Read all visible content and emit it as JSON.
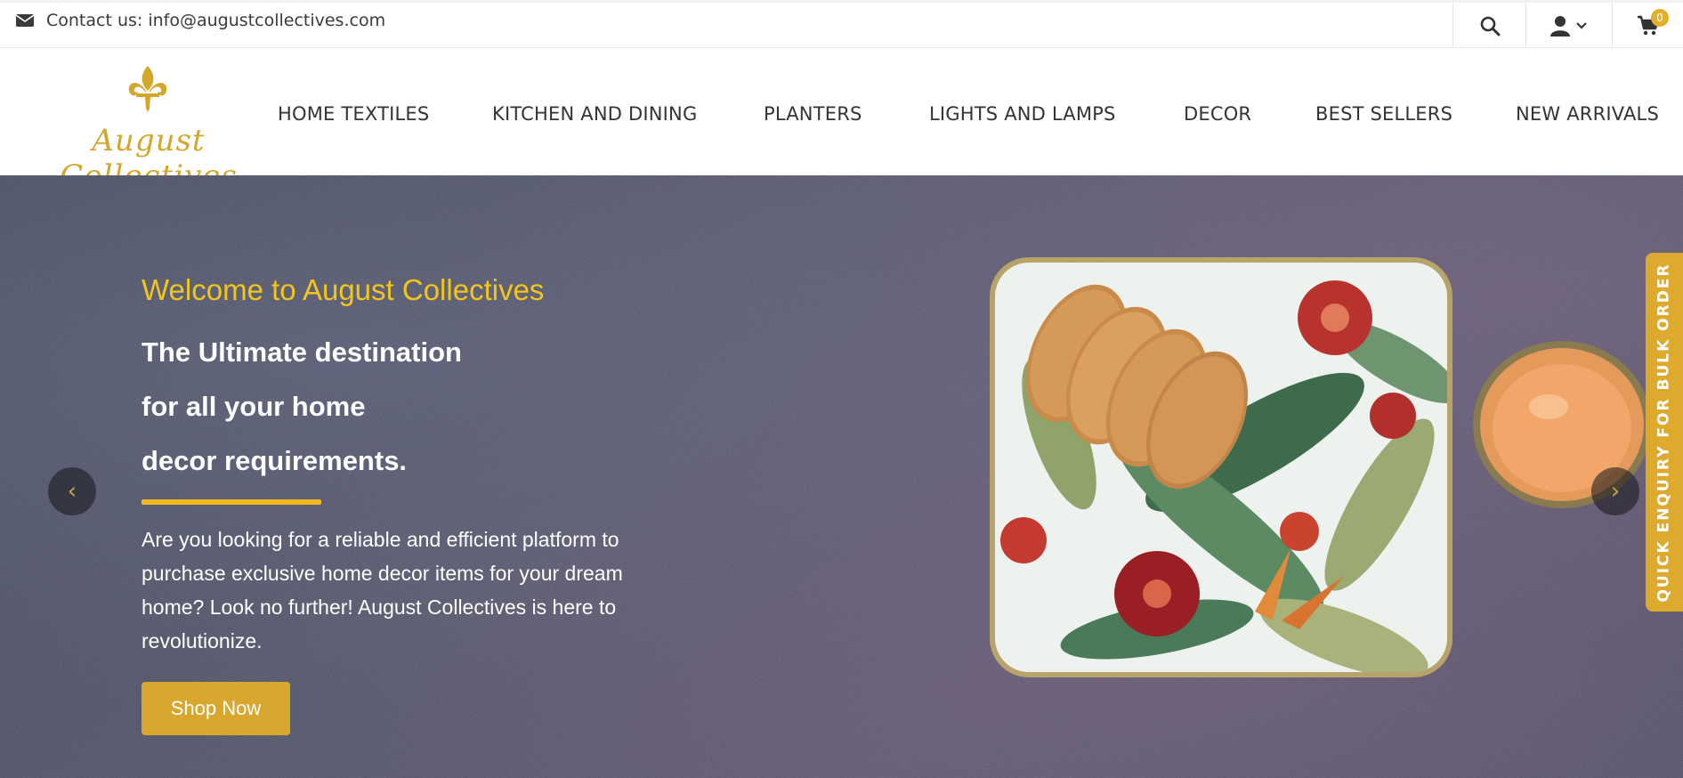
{
  "topbar": {
    "contact_label": "Contact us:",
    "contact_email": "info@augustcollectives.com",
    "icons": [
      "envelope-icon",
      "search-icon",
      "user-icon",
      "chevron-down-icon",
      "cart-icon"
    ],
    "cart_count": "0"
  },
  "header": {
    "brand": "August Collectives",
    "nav": [
      "HOME TEXTILES",
      "KITCHEN AND DINING",
      "PLANTERS",
      "LIGHTS AND LAMPS",
      "DECOR",
      "BEST SELLERS",
      "NEW ARRIVALS"
    ]
  },
  "hero": {
    "welcome": "Welcome to August Collectives",
    "headline_lines": [
      "The Ultimate destination",
      "for all your home",
      "decor requirements."
    ],
    "description": "Are you looking for a reliable and efficient platform to purchase exclusive home decor items for your dream home? Look no further! August Collectives is here to revolutionize.",
    "button": "Shop Now",
    "prev_arrow": "‹",
    "next_arrow": "›"
  },
  "side_tab": {
    "label": "QUICK ENQUIRY FOR BULK ORDER"
  },
  "colors": {
    "accent": "#d9a62e",
    "welcome_text": "#f2c51a",
    "hero_bg": "#4c4f63"
  }
}
